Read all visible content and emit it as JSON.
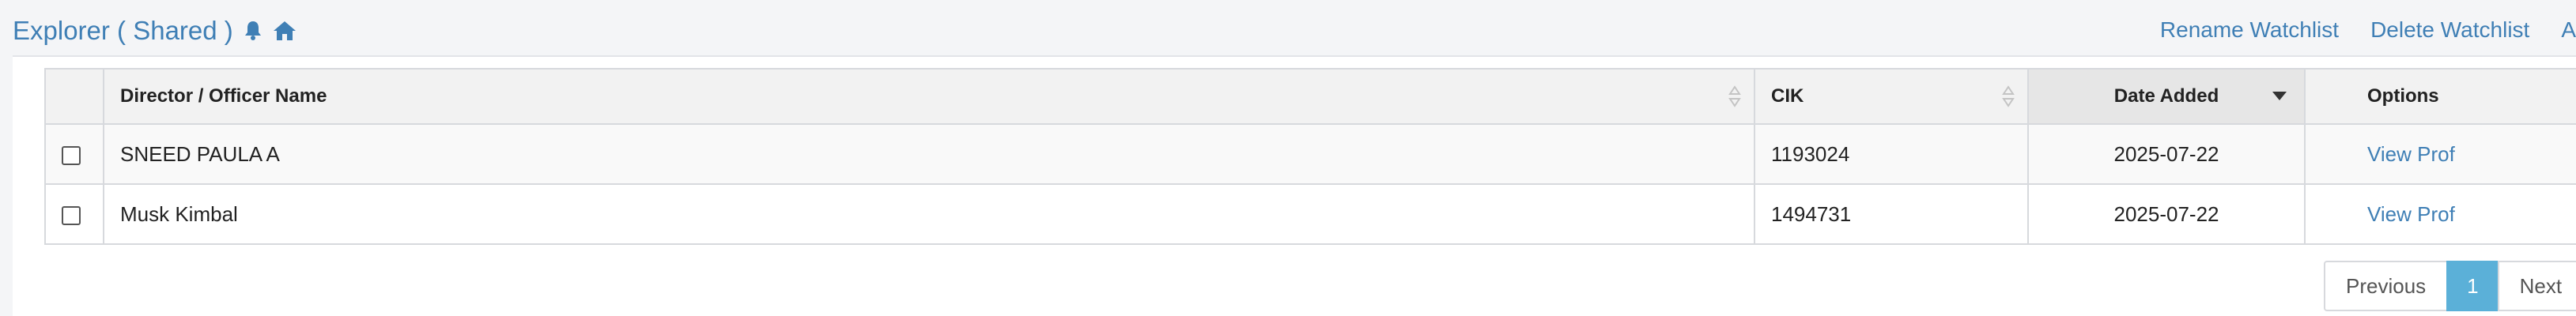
{
  "header": {
    "title": "Explorer ( Shared )",
    "icons": [
      "bell-icon",
      "home-icon"
    ],
    "actions": [
      "Rename Watchlist",
      "Delete Watchlist",
      "A"
    ]
  },
  "table": {
    "columns": [
      "Director / Officer Name",
      "CIK",
      "Date Added",
      "Options"
    ],
    "sorted_column": "Date Added",
    "sort_direction": "descending",
    "rows": [
      {
        "name": "SNEED PAULA A",
        "cik": "1193024",
        "date": "2025-07-22",
        "option": "View Prof",
        "checked": false
      },
      {
        "name": "Musk Kimbal",
        "cik": "1494731",
        "date": "2025-07-22",
        "option": "View Prof",
        "checked": false
      }
    ]
  },
  "pagination": {
    "previous": "Previous",
    "current": "1",
    "next": "Next"
  },
  "colors": {
    "link": "#3f7fb5",
    "active_page": "#5bb0d8"
  }
}
